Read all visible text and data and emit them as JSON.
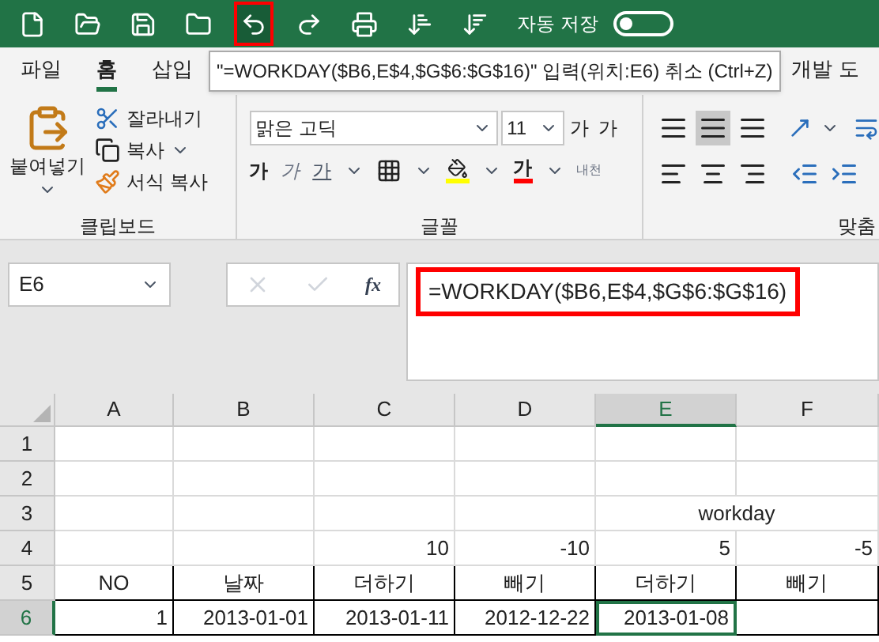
{
  "quick_access": {
    "tools": [
      {
        "kind": "new",
        "highlighted": false
      },
      {
        "kind": "open",
        "highlighted": false
      },
      {
        "kind": "save",
        "highlighted": false
      },
      {
        "kind": "folder",
        "highlighted": false
      },
      {
        "kind": "undo",
        "highlighted": true
      },
      {
        "kind": "redo",
        "highlighted": false
      },
      {
        "kind": "print",
        "highlighted": false
      },
      {
        "kind": "sort-asc",
        "highlighted": false
      },
      {
        "kind": "sort-desc",
        "highlighted": false
      }
    ],
    "autosave_label": "자동 저장",
    "autosave_on": false
  },
  "tabs": [
    {
      "label": "파일",
      "selected": false
    },
    {
      "label": "홈",
      "selected": true
    },
    {
      "label": "삽입",
      "selected": false
    }
  ],
  "tooltip": "\"=WORKDAY($B6,E$4,$G$6:$G$16)\" 입력(위치:E6) 취소 (Ctrl+Z)",
  "tabs_after": [
    {
      "label": "개발 도",
      "selected": false
    }
  ],
  "clipboard": {
    "paste": "붙여넣기",
    "cut": "잘라내기",
    "copy": "복사",
    "format_painter": "서식 복사",
    "label": "클립보드"
  },
  "font": {
    "name": "맑은 고딕",
    "size": "11",
    "grow": "가",
    "shrink": "가",
    "bold": "가",
    "italic": "가",
    "underline": "가",
    "font_color": "가",
    "phonetic": "내천",
    "label": "글꼴"
  },
  "alignment": {
    "label": "맞춤"
  },
  "name_box": "E6",
  "formula_bar": {
    "function_label": "fx",
    "text": "=WORKDAY($B6,E$4,$G$6:$G$16)",
    "highlighted": true
  },
  "grid": {
    "columns": [
      {
        "label": "A",
        "selected": false
      },
      {
        "label": "B",
        "selected": false
      },
      {
        "label": "C",
        "selected": false
      },
      {
        "label": "D",
        "selected": false
      },
      {
        "label": "E",
        "selected": true
      },
      {
        "label": "F",
        "selected": false
      }
    ],
    "rows": [
      {
        "label": "1",
        "selected": false,
        "bordered": false,
        "cells": [
          {
            "selected": false
          },
          {
            "selected": false
          },
          {
            "selected": false
          },
          {
            "selected": false
          },
          {
            "selected": false
          },
          {
            "selected": false
          }
        ]
      },
      {
        "label": "2",
        "selected": false,
        "bordered": false,
        "cells": [
          {
            "selected": false
          },
          {
            "selected": false
          },
          {
            "selected": false
          },
          {
            "selected": false
          },
          {
            "selected": false
          },
          {
            "selected": false
          }
        ]
      },
      {
        "label": "3",
        "selected": false,
        "bordered": false,
        "cells": [
          {
            "selected": false
          },
          {
            "selected": false
          },
          {
            "selected": false
          },
          {
            "selected": false
          },
          {
            "text": "workday",
            "kind": "text",
            "merged_with_next": true,
            "selected": false
          }
        ]
      },
      {
        "label": "4",
        "selected": false,
        "bordered": false,
        "cells": [
          {
            "selected": false
          },
          {
            "selected": false
          },
          {
            "text": "10",
            "kind": "number",
            "selected": false
          },
          {
            "text": "-10",
            "kind": "number",
            "selected": false
          },
          {
            "text": "5",
            "kind": "number",
            "selected": false
          },
          {
            "text": "-5",
            "kind": "number",
            "selected": false
          }
        ]
      },
      {
        "label": "5",
        "selected": false,
        "bordered": true,
        "cells": [
          {
            "text": "NO",
            "kind": "text",
            "selected": false
          },
          {
            "text": "날짜",
            "kind": "text",
            "selected": false
          },
          {
            "text": "더하기",
            "kind": "text",
            "selected": false
          },
          {
            "text": "빼기",
            "kind": "text",
            "selected": false
          },
          {
            "text": "더하기",
            "kind": "text",
            "selected": false
          },
          {
            "text": "빼기",
            "kind": "text",
            "selected": false
          }
        ]
      },
      {
        "label": "6",
        "selected": true,
        "bordered": true,
        "cells": [
          {
            "text": "1",
            "kind": "number",
            "selected": false
          },
          {
            "text": "2013-01-01",
            "kind": "number",
            "selected": false
          },
          {
            "text": "2013-01-11",
            "kind": "number",
            "selected": false
          },
          {
            "text": "2012-12-22",
            "kind": "number",
            "selected": false
          },
          {
            "text": "2013-01-08",
            "kind": "number",
            "selected": true
          },
          {
            "selected": false
          }
        ]
      }
    ]
  }
}
